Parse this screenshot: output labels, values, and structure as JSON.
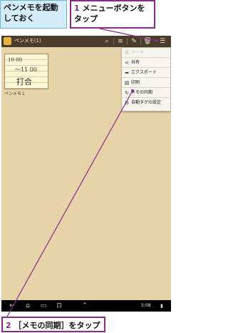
{
  "callouts": {
    "top_left": "ペンメモを起動しておく",
    "top_right_num": "1",
    "top_right_text": "メニューボタンをタップ",
    "bottom_num": "2",
    "bottom_text": "［メモの同期］をタップ"
  },
  "app": {
    "title": "ペンメモ(1)",
    "memo_label": "ペンメモ１",
    "memo_lines": [
      "10 00",
      "～11 00",
      "打合"
    ]
  },
  "menu": {
    "items": [
      {
        "label": "ソート",
        "icon": "sort-icon",
        "enabled": false
      },
      {
        "label": "共有",
        "icon": "share-icon",
        "enabled": true
      },
      {
        "label": "エクスポート",
        "icon": "export-icon",
        "enabled": true
      },
      {
        "label": "印刷",
        "icon": "print-icon",
        "enabled": true
      },
      {
        "label": "メモの同期",
        "icon": "sync-icon",
        "enabled": true
      },
      {
        "label": "自動タグの設定",
        "icon": "auto-tag-icon",
        "enabled": true
      }
    ]
  },
  "status": {
    "time": "5:08"
  },
  "colors": {
    "accent": "#8a2a8c",
    "titlebar": "#4a3d2c",
    "background": "#e6d3a7",
    "callout_blue": "#d4ecf7"
  }
}
